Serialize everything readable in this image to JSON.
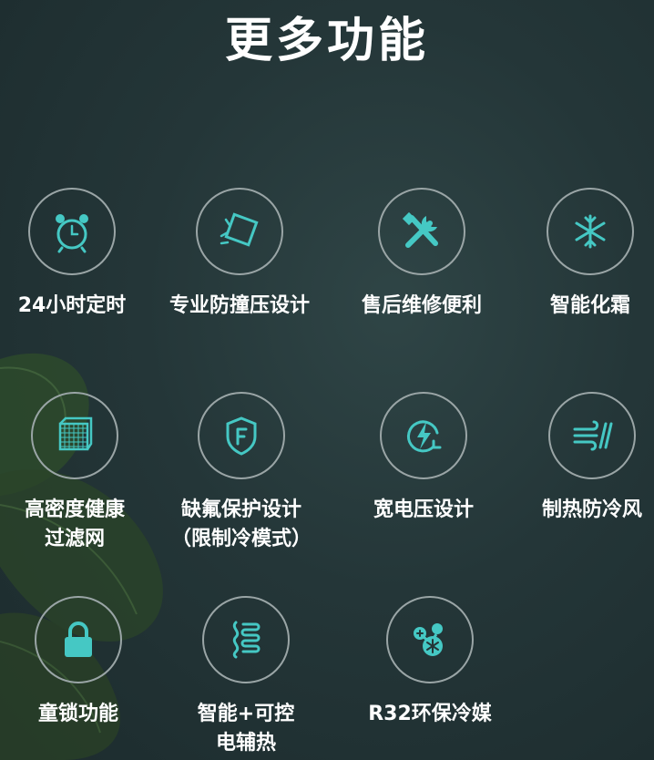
{
  "page": {
    "title": "更多功能"
  },
  "colors": {
    "icon": "#45c8c4",
    "ring": "#9aa5a6",
    "text": "#ffffff",
    "background": "#243638"
  },
  "features": [
    {
      "label_line1": "24小时定时",
      "label_line2": "",
      "icon": "alarm-clock-icon"
    },
    {
      "label_line1": "专业防撞压设计",
      "label_line2": "",
      "icon": "anti-collision-icon"
    },
    {
      "label_line1": "售后维修便利",
      "label_line2": "",
      "icon": "repair-tools-icon"
    },
    {
      "label_line1": "智能化霜",
      "label_line2": "",
      "icon": "snowflake-icon"
    },
    {
      "label_line1": "高密度健康",
      "label_line2": "过滤网",
      "icon": "filter-mesh-icon"
    },
    {
      "label_line1": "缺氟保护设计",
      "label_line2": "（限制冷模式）",
      "icon": "fluorine-shield-icon"
    },
    {
      "label_line1": "宽电压设计",
      "label_line2": "",
      "icon": "voltage-icon"
    },
    {
      "label_line1": "制热防冷风",
      "label_line2": "",
      "icon": "warm-wind-icon"
    },
    {
      "label_line1": "童锁功能",
      "label_line2": "",
      "icon": "lock-icon"
    },
    {
      "label_line1": "智能+可控",
      "label_line2": "电辅热",
      "icon": "electric-heater-icon"
    },
    {
      "label_line1": "R32环保冷媒",
      "label_line2": "",
      "icon": "refrigerant-icon"
    }
  ]
}
